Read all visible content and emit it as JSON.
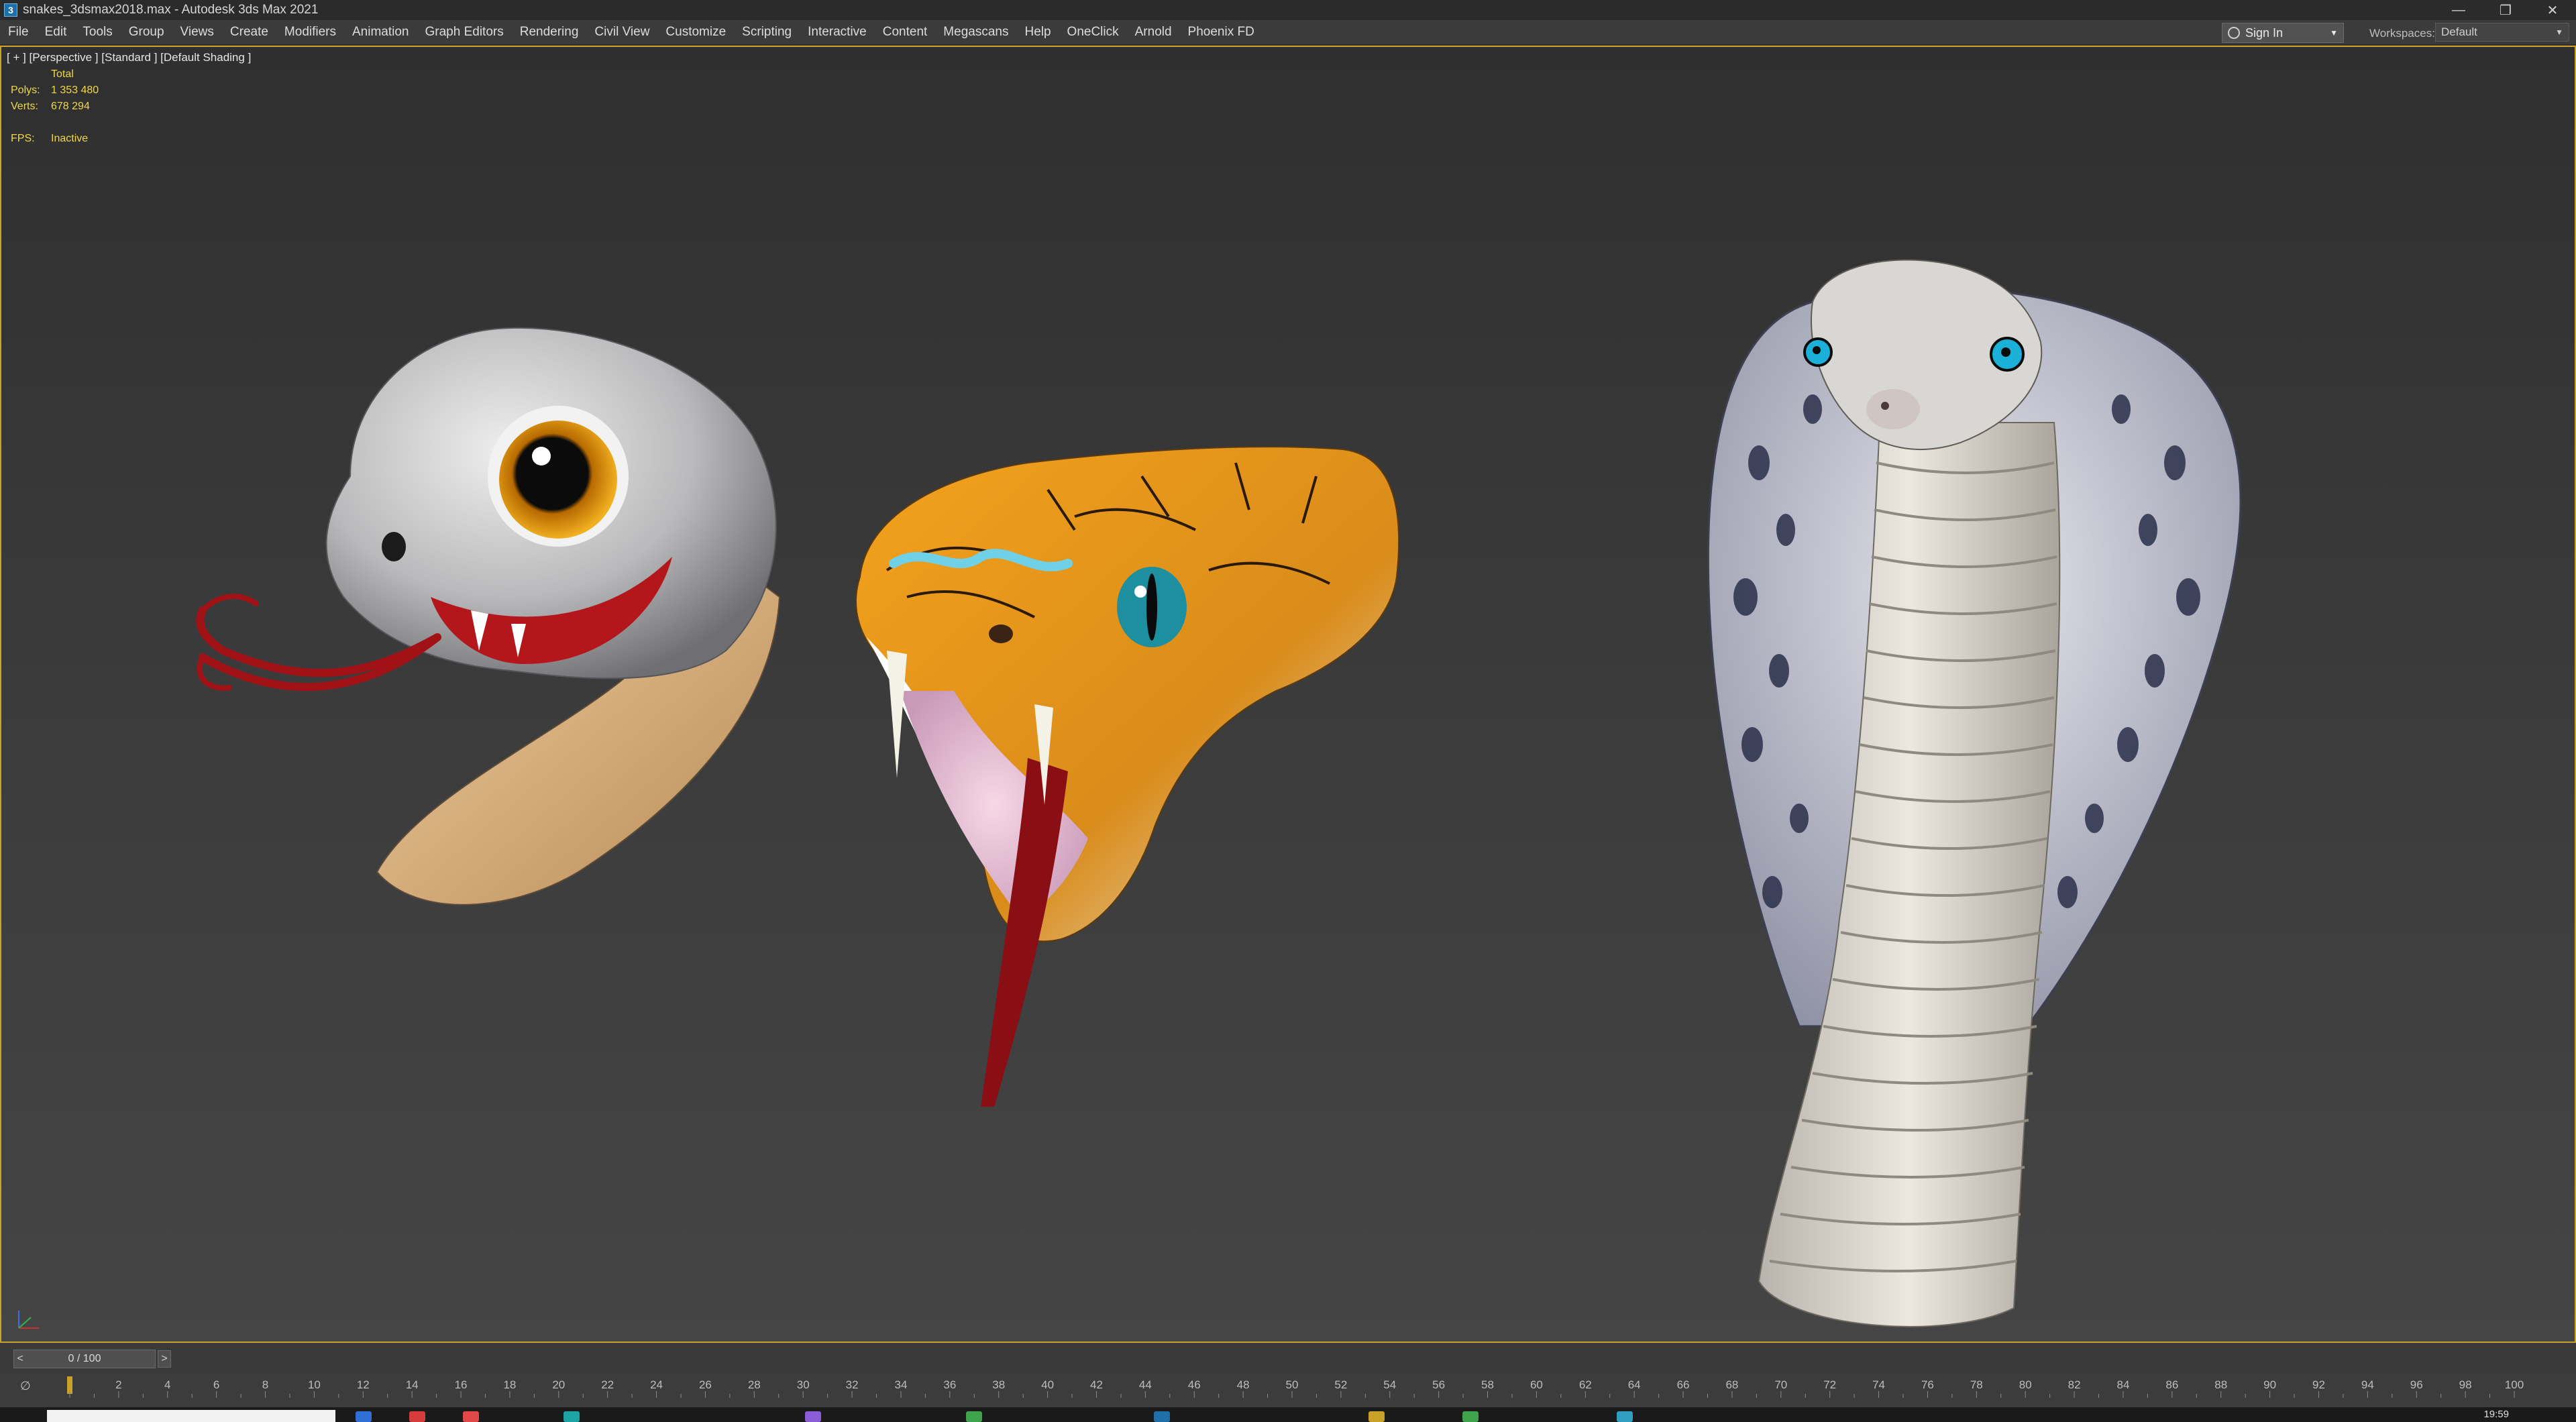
{
  "window": {
    "title": "snakes_3dsmax2018.max - Autodesk 3ds Max 2021",
    "app_icon": "3"
  },
  "menu": [
    "File",
    "Edit",
    "Tools",
    "Group",
    "Views",
    "Create",
    "Modifiers",
    "Animation",
    "Graph Editors",
    "Rendering",
    "Civil View",
    "Customize",
    "Scripting",
    "Interactive",
    "Content",
    "Megascans",
    "Help",
    "OneClick",
    "Arnold",
    "Phoenix FD"
  ],
  "signin": {
    "label": "Sign In"
  },
  "workspaces": {
    "label": "Workspaces:",
    "value": "Default"
  },
  "viewport": {
    "label": "[ + ] [Perspective ] [Standard ] [Default Shading ]",
    "stats": {
      "total_label": "Total",
      "polys_label": "Polys:",
      "polys_value": "1 353 480",
      "verts_label": "Verts:",
      "verts_value": "678 294",
      "fps_label": "FPS:",
      "fps_value": "Inactive"
    },
    "objects": [
      "cartoon-snake-head",
      "viper-head",
      "cobra"
    ]
  },
  "time_slider": {
    "value": "0 / 100",
    "prev": "<",
    "next": ">"
  },
  "track_ticks": [
    "2",
    "4",
    "6",
    "8",
    "10",
    "12",
    "14",
    "16",
    "18",
    "20",
    "22",
    "24",
    "26",
    "28",
    "30",
    "32",
    "34",
    "36",
    "38",
    "40",
    "42",
    "44",
    "46",
    "48",
    "50",
    "52",
    "54",
    "56",
    "58",
    "60",
    "62",
    "64",
    "66",
    "68",
    "70",
    "72",
    "74",
    "76",
    "78",
    "80",
    "82",
    "84",
    "86",
    "88",
    "90",
    "92",
    "94",
    "96",
    "98",
    "100"
  ],
  "taskbar": {
    "time": "19:59"
  },
  "colors": {
    "viewport_border": "#c9a227",
    "stats_text": "#f0d84a"
  }
}
